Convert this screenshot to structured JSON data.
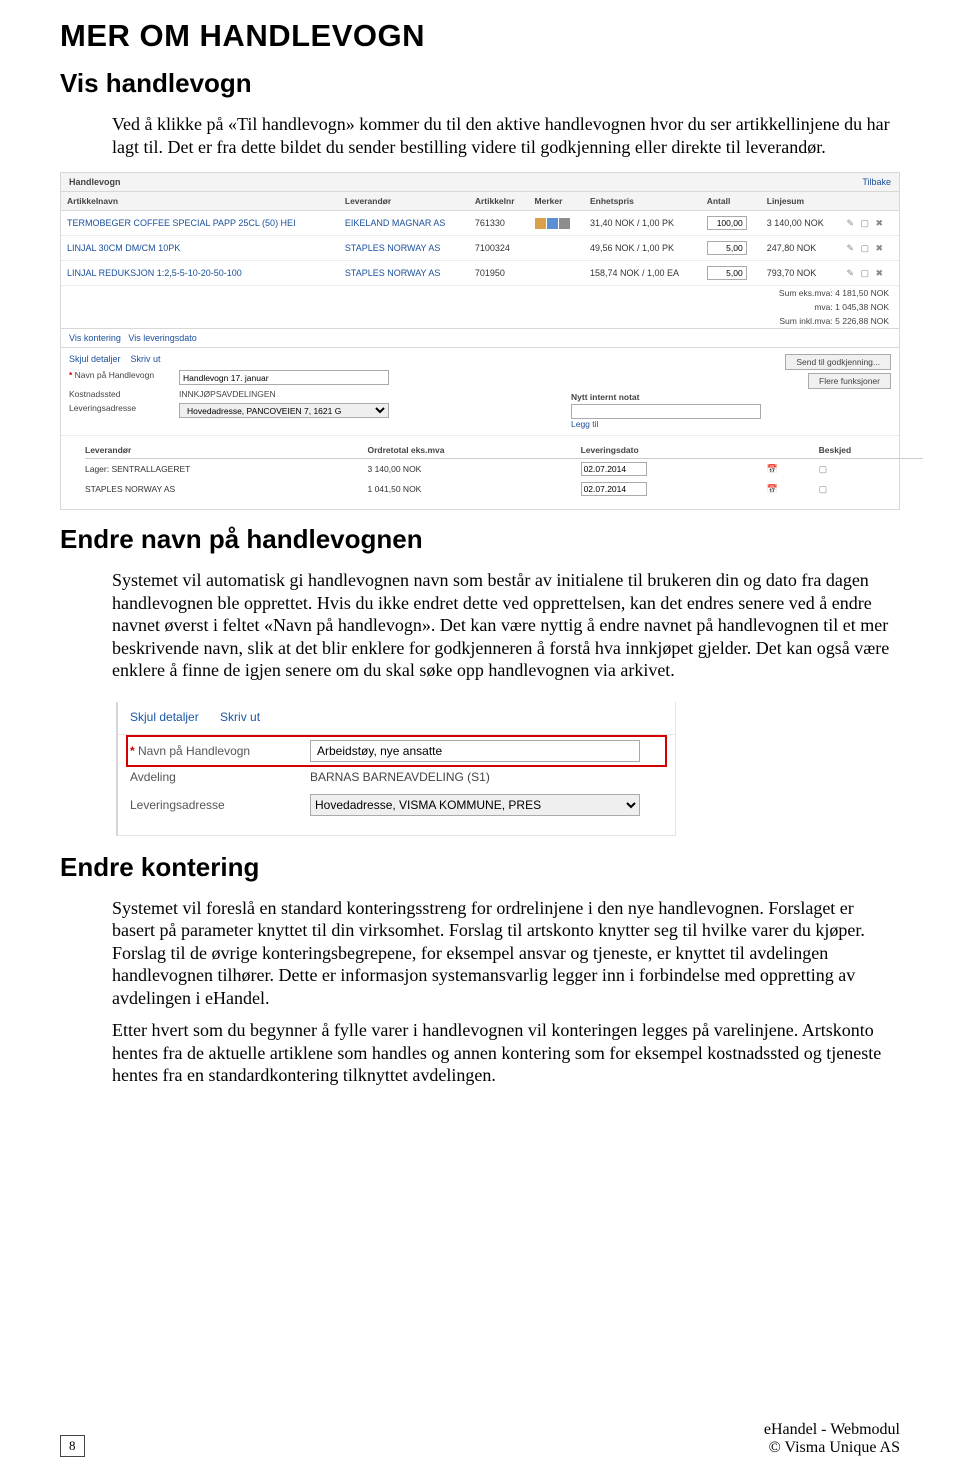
{
  "headings": {
    "h1": "MER OM HANDLEVOGN",
    "vis": "Vis handlevogn",
    "endre_navn": "Endre navn på handlevognen",
    "endre_kont": "Endre kontering"
  },
  "paragraphs": {
    "p1": "Ved å klikke på «Til handlevogn» kommer du til den aktive handlevognen hvor du ser artikkellinjene du har lagt til. Det er fra dette bildet du sender bestilling videre til godkjenning eller direkte til leverandør.",
    "p2": "Systemet vil automatisk gi handlevognen navn som består av initialene til brukeren din og dato fra dagen handlevognen ble opprettet. Hvis du ikke endret dette ved opprettelsen, kan det endres senere ved å endre navnet øverst i feltet «Navn på handlevogn». Det kan være nyttig å endre navnet på handlevognen til et mer beskrivende navn, slik at det blir enklere for godkjenneren å forstå hva innkjøpet gjelder. Det kan også være enklere å finne de igjen senere om du skal søke opp handlevognen via arkivet.",
    "p3": "Systemet vil foreslå en standard konteringsstreng for ordrelinjene i den nye handlevognen. Forslaget er basert på parameter knyttet til din virksomhet. Forslag til artskonto knytter seg til hvilke varer du kjøper. Forslag til de øvrige konteringsbegrepene, for eksempel ansvar og tjeneste, er knyttet til avdelingen handlevognen tilhører. Dette er informasjon systemansvarlig legger inn i forbindelse med oppretting av avdelingen i eHandel.",
    "p4": "Etter hvert som du begynner å fylle varer i handlevognen vil konteringen legges på varelinjene. Artskonto hentes fra de aktuelle artiklene som handles og annen kontering som for eksempel kostnadssted og tjeneste hentes fra en standardkontering tilknyttet avdelingen."
  },
  "shot1": {
    "title": "Handlevogn",
    "back": "Tilbake",
    "cols": {
      "c1": "Artikkelnavn",
      "c2": "Leverandør",
      "c3": "Artikkelnr",
      "c4": "Merker",
      "c5": "Enhetspris",
      "c6": "Antall",
      "c7": "Linjesum"
    },
    "rows": [
      {
        "name": "TERMOBEGER COFFEE SPECIAL PAPP 25CL (50) HEI",
        "lev": "EIKELAND MAGNAR AS",
        "nr": "761330",
        "merker": true,
        "pris": "31,40 NOK / 1,00 PK",
        "antall": "100,00",
        "sum": "3 140,00 NOK"
      },
      {
        "name": "LINJAL 30CM DM/CM 10PK",
        "lev": "STAPLES NORWAY AS",
        "nr": "7100324",
        "merker": false,
        "pris": "49,56 NOK / 1,00 PK",
        "antall": "5,00",
        "sum": "247,80 NOK"
      },
      {
        "name": "LINJAL REDUKSJON 1:2,5-5-10-20-50-100",
        "lev": "STAPLES NORWAY AS",
        "nr": "701950",
        "merker": false,
        "pris": "158,74 NOK / 1,00 EA",
        "antall": "5,00",
        "sum": "793,70 NOK"
      }
    ],
    "sums": {
      "s1": "Sum eks.mva: 4 181,50 NOK",
      "s2": "mva: 1 045,38 NOK",
      "s3": "Sum inkl.mva: 5 226,88 NOK"
    },
    "midlinks": {
      "a": "Vis kontering",
      "b": "Vis leveringsdato"
    },
    "detail_links": {
      "a": "Skjul detaljer",
      "b": "Skriv ut"
    },
    "details": {
      "navn_label": "Navn på Handlevogn",
      "navn_val": "Handlevogn 17. januar",
      "kost_label": "Kostnadssted",
      "kost_val": "INNKJØPSAVDELINGEN",
      "lev_label": "Leveringsadresse",
      "lev_val": "Hovedadresse, PANCOVEIEN 7, 1621 G"
    },
    "right": {
      "notat_label": "Nytt internt notat",
      "send_btn": "Send til godkjenning...",
      "flere_btn": "Flere funksjoner",
      "leggtil": "Legg til"
    },
    "ord_cols": {
      "c1": "Leverandør",
      "c2": "Ordretotal eks.mva",
      "c3": "Leveringsdato",
      "c4": "Beskjed"
    },
    "ord_rows": [
      {
        "lev": "Lager: SENTRALLAGERET",
        "tot": "3 140,00 NOK",
        "dato": "02.07.2014"
      },
      {
        "lev": "STAPLES NORWAY AS",
        "tot": "1 041,50 NOK",
        "dato": "02.07.2014"
      }
    ]
  },
  "shot2": {
    "links": {
      "a": "Skjul detaljer",
      "b": "Skriv ut"
    },
    "rows": {
      "navn_label": "Navn på Handlevogn",
      "navn_val": "Arbeidstøy, nye ansatte",
      "avd_label": "Avdeling",
      "avd_val": "BARNAS BARNEAVDELING (S1)",
      "lev_label": "Leveringsadresse",
      "lev_val": "Hovedadresse, VISMA KOMMUNE, PRES"
    }
  },
  "footer": {
    "page": "8",
    "r1": "eHandel - Webmodul",
    "r2": "© Visma Unique AS"
  }
}
